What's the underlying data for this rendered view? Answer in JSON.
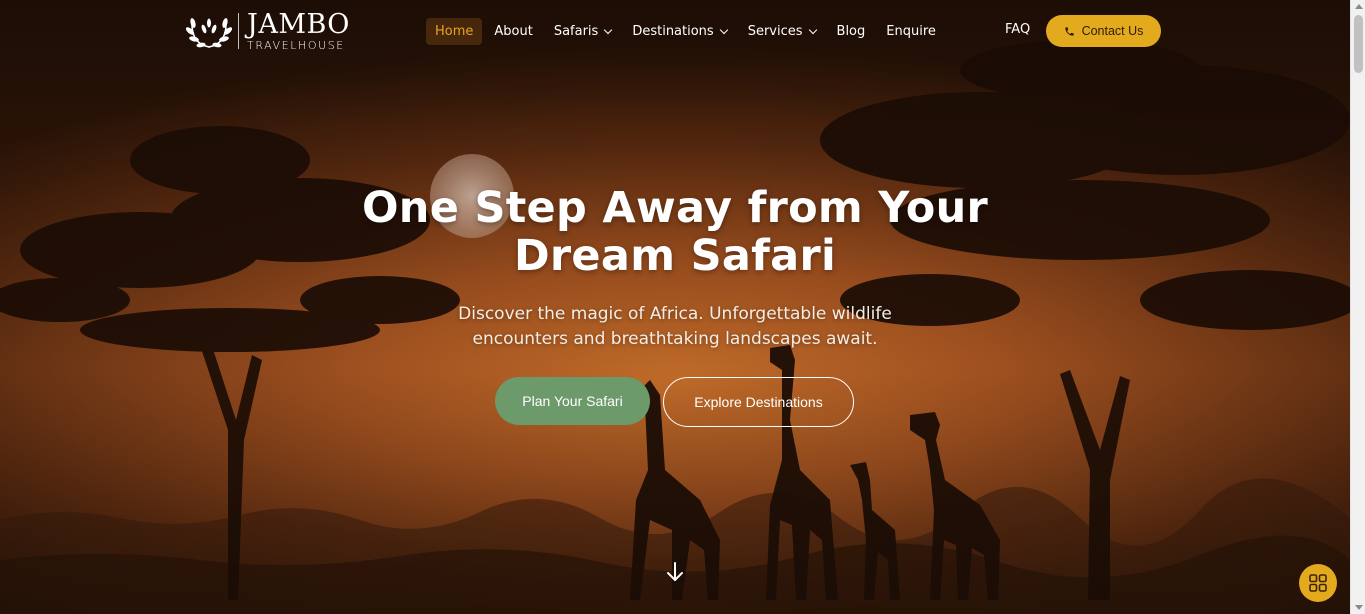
{
  "brand": {
    "name": "JAMBO",
    "subtitle": "TRAVELHOUSE"
  },
  "nav": {
    "items": [
      {
        "label": "Home",
        "active": true,
        "dropdown": false
      },
      {
        "label": "About",
        "active": false,
        "dropdown": false
      },
      {
        "label": "Safaris",
        "active": false,
        "dropdown": true
      },
      {
        "label": "Destinations",
        "active": false,
        "dropdown": true
      },
      {
        "label": "Services",
        "active": false,
        "dropdown": true
      },
      {
        "label": "Blog",
        "active": false,
        "dropdown": false
      },
      {
        "label": "Enquire",
        "active": false,
        "dropdown": false
      }
    ],
    "faq": "FAQ",
    "contact": "Contact Us"
  },
  "hero": {
    "headline_line1": "One Step Away from Your",
    "headline_line2": "Dream Safari",
    "subtext_line1": "Discover the magic of Africa. Unforgettable wildlife",
    "subtext_line2": "encounters and breathtaking landscapes await.",
    "primary_cta": "Plan Your Safari",
    "secondary_cta": "Explore Destinations"
  },
  "icons": {
    "logo": "laurel-wreath-icon",
    "contact": "phone-icon",
    "scroll": "arrow-down-icon",
    "fab": "grid-icon"
  },
  "colors": {
    "accent": "#e4aa1e",
    "active_nav": "#e2a520",
    "primary_button": "#6d9a6a"
  }
}
